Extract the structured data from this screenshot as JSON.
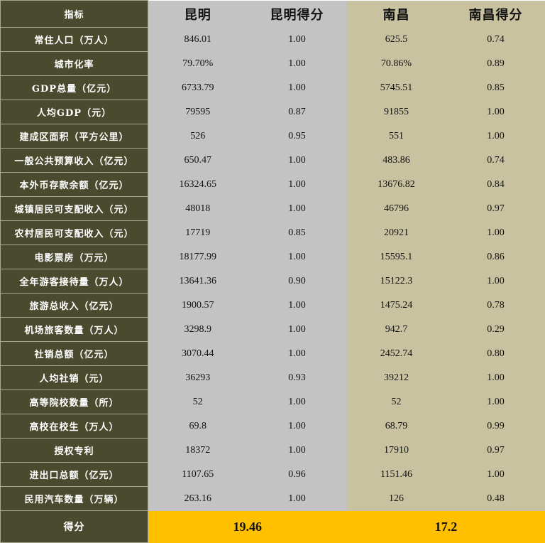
{
  "header": {
    "indicator": "指标",
    "kunming": "昆明",
    "kunming_score": "昆明得分",
    "nanchang": "南昌",
    "nanchang_score": "南昌得分"
  },
  "rows": [
    {
      "indicator": "常住人口（万人）",
      "kunming": "846.01",
      "kunming_score": "1.00",
      "nanchang": "625.5",
      "nanchang_score": "0.74"
    },
    {
      "indicator": "城市化率",
      "kunming": "79.70%",
      "kunming_score": "1.00",
      "nanchang": "70.86%",
      "nanchang_score": "0.89"
    },
    {
      "indicator": "GDP总量（亿元）",
      "kunming": "6733.79",
      "kunming_score": "1.00",
      "nanchang": "5745.51",
      "nanchang_score": "0.85"
    },
    {
      "indicator": "人均GDP（元）",
      "kunming": "79595",
      "kunming_score": "0.87",
      "nanchang": "91855",
      "nanchang_score": "1.00"
    },
    {
      "indicator": "建成区面积（平方公里）",
      "kunming": "526",
      "kunming_score": "0.95",
      "nanchang": "551",
      "nanchang_score": "1.00"
    },
    {
      "indicator": "一般公共预算收入（亿元）",
      "kunming": "650.47",
      "kunming_score": "1.00",
      "nanchang": "483.86",
      "nanchang_score": "0.74"
    },
    {
      "indicator": "本外币存款余额（亿元）",
      "kunming": "16324.65",
      "kunming_score": "1.00",
      "nanchang": "13676.82",
      "nanchang_score": "0.84"
    },
    {
      "indicator": "城镇居民可支配收入（元）",
      "kunming": "48018",
      "kunming_score": "1.00",
      "nanchang": "46796",
      "nanchang_score": "0.97"
    },
    {
      "indicator": "农村居民可支配收入（元）",
      "kunming": "17719",
      "kunming_score": "0.85",
      "nanchang": "20921",
      "nanchang_score": "1.00"
    },
    {
      "indicator": "电影票房（万元）",
      "kunming": "18177.99",
      "kunming_score": "1.00",
      "nanchang": "15595.1",
      "nanchang_score": "0.86"
    },
    {
      "indicator": "全年游客接待量（万人）",
      "kunming": "13641.36",
      "kunming_score": "0.90",
      "nanchang": "15122.3",
      "nanchang_score": "1.00"
    },
    {
      "indicator": "旅游总收入（亿元）",
      "kunming": "1900.57",
      "kunming_score": "1.00",
      "nanchang": "1475.24",
      "nanchang_score": "0.78"
    },
    {
      "indicator": "机场旅客数量（万人）",
      "kunming": "3298.9",
      "kunming_score": "1.00",
      "nanchang": "942.7",
      "nanchang_score": "0.29"
    },
    {
      "indicator": "社销总额（亿元）",
      "kunming": "3070.44",
      "kunming_score": "1.00",
      "nanchang": "2452.74",
      "nanchang_score": "0.80"
    },
    {
      "indicator": "人均社销（元）",
      "kunming": "36293",
      "kunming_score": "0.93",
      "nanchang": "39212",
      "nanchang_score": "1.00"
    },
    {
      "indicator": "高等院校数量（所）",
      "kunming": "52",
      "kunming_score": "1.00",
      "nanchang": "52",
      "nanchang_score": "1.00"
    },
    {
      "indicator": "高校在校生（万人）",
      "kunming": "69.8",
      "kunming_score": "1.00",
      "nanchang": "68.79",
      "nanchang_score": "0.99"
    },
    {
      "indicator": "授权专利",
      "kunming": "18372",
      "kunming_score": "1.00",
      "nanchang": "17910",
      "nanchang_score": "0.97"
    },
    {
      "indicator": "进出口总额（亿元）",
      "kunming": "1107.65",
      "kunming_score": "0.96",
      "nanchang": "1151.46",
      "nanchang_score": "1.00"
    },
    {
      "indicator": "民用汽车数量（万辆）",
      "kunming": "263.16",
      "kunming_score": "1.00",
      "nanchang": "126",
      "nanchang_score": "0.48"
    }
  ],
  "footer": {
    "label": "得分",
    "kunming_total": "19.46",
    "nanchang_total": "17.2"
  },
  "colors": {
    "indicator_bg": "#4a4a2f",
    "kunming_bg": "#c3c3c3",
    "nanchang_bg": "#c8c2a0",
    "total_bg": "#ffc000"
  }
}
